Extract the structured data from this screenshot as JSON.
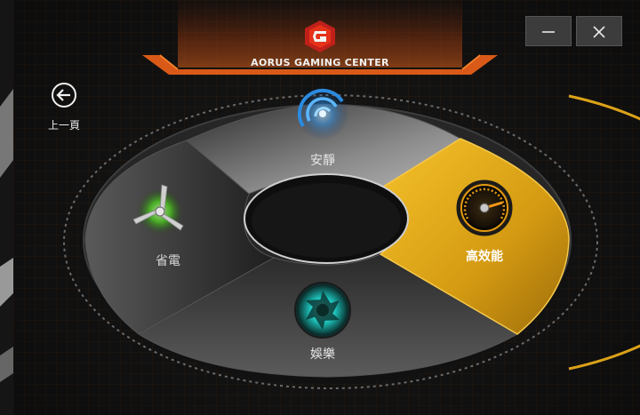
{
  "app": {
    "title": "AORUS GAMING CENTER",
    "logo_icon": "aorus-logo-icon"
  },
  "window_controls": {
    "minimize_icon": "minimize-icon",
    "close_icon": "close-icon"
  },
  "nav": {
    "back_label": "上一頁",
    "back_icon": "arrow-left-circle-icon"
  },
  "modes": [
    {
      "id": "quiet",
      "label": "安靜",
      "icon": "sound-wave-icon",
      "icon_color": "#2a8be0",
      "selected": false
    },
    {
      "id": "power-saving",
      "label": "省電",
      "icon": "fan-icon",
      "icon_color": "#4bd21b",
      "selected": false
    },
    {
      "id": "high-performance",
      "label": "高效能",
      "icon": "speedometer-icon",
      "icon_color": "#e29a12",
      "selected": true
    },
    {
      "id": "entertainment",
      "label": "娛樂",
      "icon": "aperture-icon",
      "icon_color": "#1fc8c0",
      "selected": false
    }
  ],
  "colors": {
    "accent": "#f2b21a",
    "brand_red": "#e53219",
    "panel_dark": "#2a2a2a"
  }
}
